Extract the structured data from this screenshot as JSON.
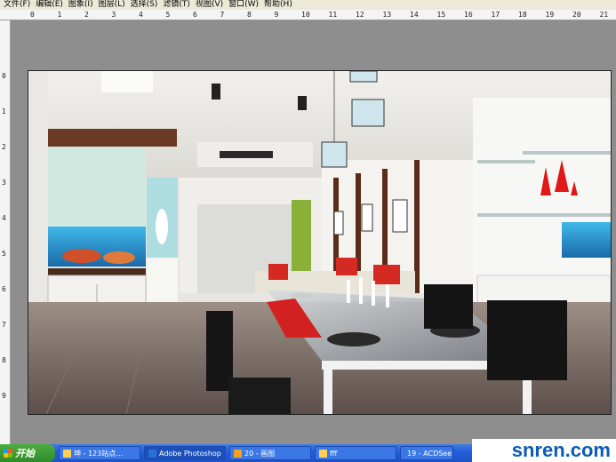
{
  "menu": [
    "文件(F)",
    "编辑(E)",
    "图象(I)",
    "图层(L)",
    "选择(S)",
    "滤镜(T)",
    "视图(V)",
    "窗口(W)",
    "帮助(H)"
  ],
  "ruler_h": [
    "0",
    "1",
    "2",
    "3",
    "4",
    "5",
    "6",
    "7",
    "8",
    "9",
    "10",
    "11",
    "12",
    "13",
    "14",
    "15",
    "16",
    "17",
    "18",
    "19",
    "20",
    "21"
  ],
  "ruler_v": [
    "0",
    "1",
    "2",
    "3",
    "4",
    "5",
    "6",
    "7",
    "8",
    "9"
  ],
  "taskbar": {
    "start_label": "开始",
    "items": [
      "坤 - 123站点…",
      "Adobe Photoshop",
      "20 - 画图",
      "fff",
      "19 - ACDSee"
    ]
  },
  "watermark": "snren.com",
  "colors": {
    "start": "#2e8b2a",
    "taskbar": "#245edb",
    "brand": "#0c5bb5"
  }
}
